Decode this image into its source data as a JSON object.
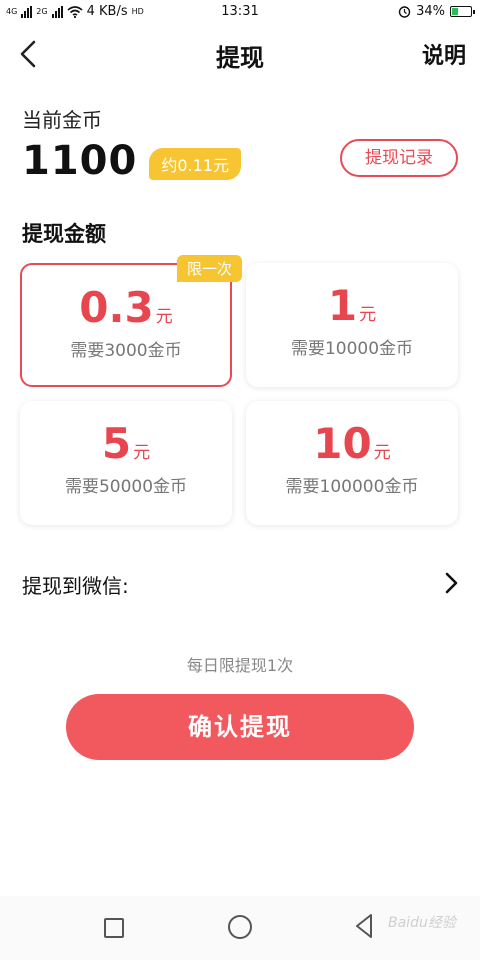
{
  "status_bar": {
    "net_label_1": "4G",
    "net_label_2": "2G",
    "speed": "4 KB/s",
    "hd": "HD",
    "time": "13:31",
    "battery": "34%",
    "battery_level": 0.34
  },
  "nav": {
    "title": "提现",
    "help": "说明"
  },
  "balance": {
    "label": "当前金币",
    "value": "1100",
    "approx": "约0.11元",
    "record_button": "提现记录"
  },
  "amount_section": {
    "title": "提现金额",
    "options": [
      {
        "amount": "0.3",
        "unit": "元",
        "cost": "需要3000金币",
        "tag": "限一次",
        "selected": true
      },
      {
        "amount": "1",
        "unit": "元",
        "cost": "需要10000金币",
        "tag": "",
        "selected": false
      },
      {
        "amount": "5",
        "unit": "元",
        "cost": "需要50000金币",
        "tag": "",
        "selected": false
      },
      {
        "amount": "10",
        "unit": "元",
        "cost": "需要100000金币",
        "tag": "",
        "selected": false
      }
    ]
  },
  "wechat": {
    "label": "提现到微信:"
  },
  "daily_limit": "每日限提现1次",
  "confirm_button": "确认提现",
  "watermark": "Baidu经验",
  "colors": {
    "accent": "#e84b55",
    "tag": "#f7c531",
    "button": "#f2595e"
  }
}
